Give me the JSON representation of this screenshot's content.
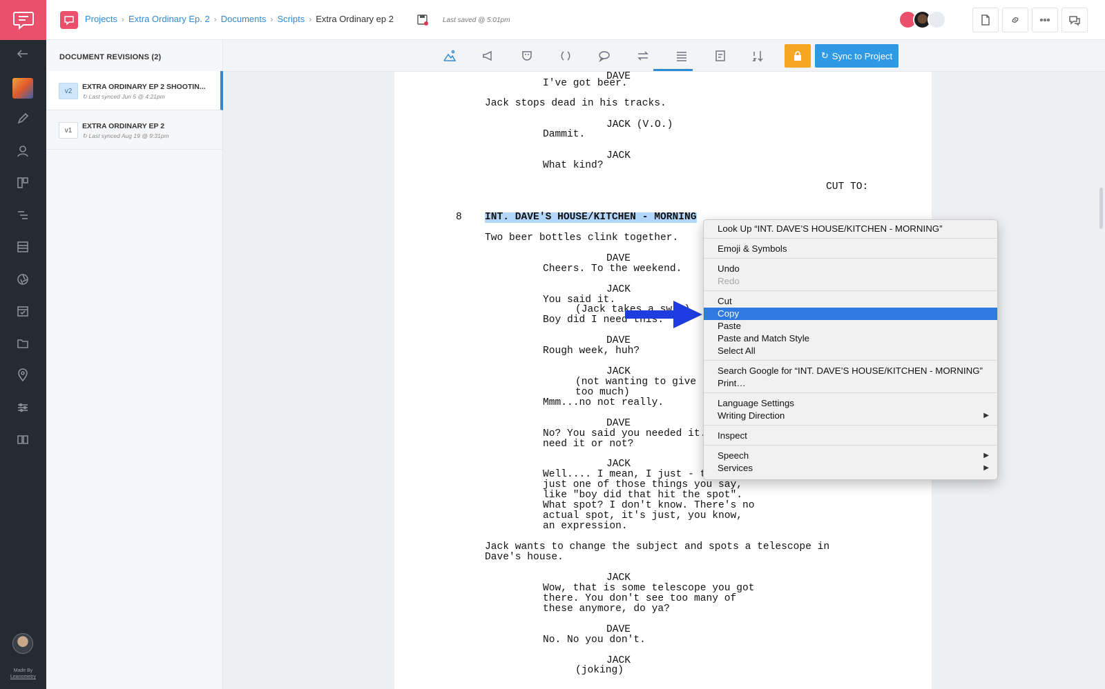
{
  "rail": {
    "made_by_line1": "Made By",
    "made_by_line2": "Leanometry"
  },
  "breadcrumb": {
    "items": [
      "Projects",
      "Extra Ordinary Ep. 2",
      "Documents",
      "Scripts"
    ],
    "current": "Extra Ordinary ep 2"
  },
  "header": {
    "last_saved": "Last saved @ 5:01pm"
  },
  "sidebar": {
    "title": "DOCUMENT REVISIONS (2)",
    "revisions": [
      {
        "version": "v2",
        "name": "EXTRA ORDINARY EP 2 SHOOTIN...",
        "synced": "Last synced Jun 5 @ 4:21pm"
      },
      {
        "version": "v1",
        "name": "EXTRA ORDINARY EP 2",
        "synced": "Last synced Aug 19 @ 9:31pm"
      }
    ]
  },
  "toolbar": {
    "sync_label": "Sync to Project"
  },
  "script": {
    "lines": [
      "DAVE",
      "I've got beer.",
      "Jack stops dead in his tracks.",
      "JACK (V.O.)",
      "Dammit.",
      "JACK",
      "What kind?",
      "CUT TO:",
      "8",
      "INT. DAVE'S HOUSE/KITCHEN - MORNING",
      "Two beer bottles clink together.",
      "DAVE",
      "Cheers. To the weekend.",
      "JACK",
      "You said it.",
      "(Jack takes a swig)",
      "Boy did I need this.",
      "DAVE",
      "Rough week, huh?",
      "JACK",
      "(not wanting to give",
      "too much)",
      "Mmm...no not really.",
      "DAVE",
      "No? You said you needed it.",
      "need it or not?",
      "JACK",
      "Well.... I mean, I just - that's",
      "just one of those things you say,",
      "like \"boy did that hit the spot\".",
      "What spot? I don't know. There's no",
      "actual spot, it's just, you know,",
      "an expression.",
      "Jack wants to change the subject and spots a telescope in",
      "Dave's house.",
      "JACK",
      "Wow, that is some telescope you got",
      "there. You don't see too many of",
      "these anymore, do ya?",
      "DAVE",
      "No. No you don't.",
      "JACK",
      "(joking)"
    ]
  },
  "context_menu": {
    "items": [
      "Look Up “INT. DAVE’S HOUSE/KITCHEN - MORNING”",
      "Emoji & Symbols",
      "Undo",
      "Redo",
      "Cut",
      "Copy",
      "Paste",
      "Paste and Match Style",
      "Select All",
      "Search Google for “INT. DAVE’S HOUSE/KITCHEN - MORNING”",
      "Print…",
      "Language Settings",
      "Writing Direction",
      "Inspect",
      "Speech",
      "Services"
    ],
    "selected": "Copy",
    "disabled": [
      "Redo"
    ],
    "submenu_arrow": "▶"
  },
  "colors": {
    "brand": "#ea4f6b",
    "accent": "#2e8ad8",
    "lock": "#f5a623",
    "menu_highlight": "#2e7ae0",
    "arrow": "#1f3ce0"
  }
}
